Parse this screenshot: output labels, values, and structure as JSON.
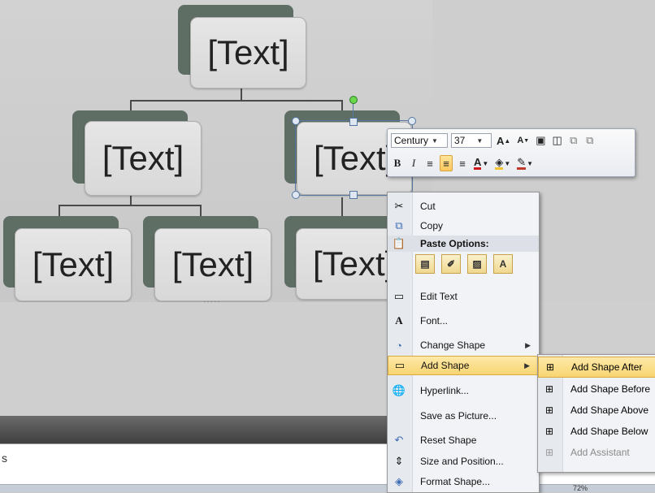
{
  "smartart": {
    "nodes": [
      {
        "id": "top",
        "text": "[Text]"
      },
      {
        "id": "mid-left",
        "text": "[Text]"
      },
      {
        "id": "mid-right",
        "text": "[Text]"
      },
      {
        "id": "bot-1",
        "text": "[Text]"
      },
      {
        "id": "bot-2",
        "text": "[Text]"
      },
      {
        "id": "bot-3",
        "text": "[Text]"
      }
    ]
  },
  "mini_toolbar": {
    "font_name": "Century",
    "font_size": "37",
    "icons": [
      "grow-font-icon",
      "shrink-font-icon",
      "quick-styles-icon",
      "shape-styles-icon",
      "bring-forward-icon",
      "send-backward-icon",
      "bold-icon",
      "italic-icon",
      "align-left-icon",
      "align-center-icon",
      "align-right-icon",
      "font-color-icon",
      "shape-fill-icon",
      "shape-outline-icon"
    ]
  },
  "context_menu": {
    "cut": "Cut",
    "copy": "Copy",
    "paste_header": "Paste Options:",
    "edit_text": "Edit Text",
    "font": "Font...",
    "change_shape": "Change Shape",
    "add_shape": "Add Shape",
    "hyperlink": "Hyperlink...",
    "save_as_picture": "Save as Picture...",
    "reset_shape": "Reset Shape",
    "size_and_position": "Size and Position...",
    "format_shape": "Format Shape..."
  },
  "submenu": {
    "after": "Add Shape After",
    "before": "Add Shape Before",
    "above": "Add Shape Above",
    "below": "Add Shape Below",
    "assistant": "Add Assistant"
  },
  "status": {
    "zoom": "72%"
  },
  "colors": {
    "shape_back": "#5f6e64",
    "shape_front": "#e0e0e0",
    "highlight": "#f8d572",
    "selection": "#5678a0"
  }
}
